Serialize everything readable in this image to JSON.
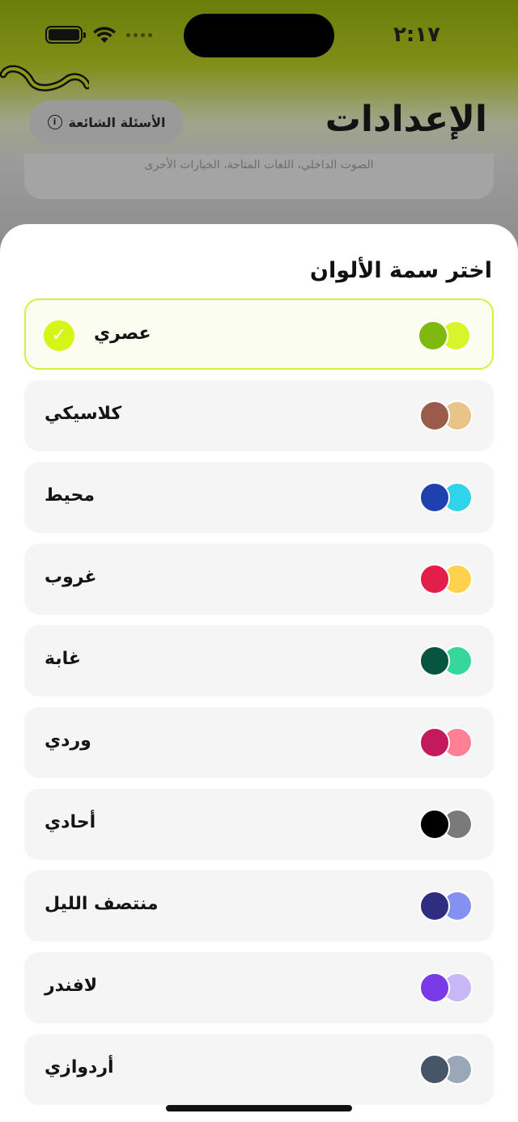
{
  "status_bar": {
    "time": "٢:١٧"
  },
  "header": {
    "title": "الإعدادات",
    "faq_label": "الأسئلة الشائعة",
    "faq_icon": "i",
    "bg_card_text": "الصوت الداخلي، اللغات المتاحة، الخيارات الأخرى"
  },
  "sheet": {
    "title": "اختر سمة الألوان",
    "check_mark": "✓",
    "themes": [
      {
        "name": "عصري",
        "primary": "#7fb80e",
        "secondary": "#d8f52c",
        "selected": true
      },
      {
        "name": "كلاسيكي",
        "primary": "#9a5b4a",
        "secondary": "#e9c488",
        "selected": false
      },
      {
        "name": "محيط",
        "primary": "#1f41b0",
        "secondary": "#2fd3ea",
        "selected": false
      },
      {
        "name": "غروب",
        "primary": "#e31e4b",
        "secondary": "#ffd24d",
        "selected": false
      },
      {
        "name": "غابة",
        "primary": "#07553f",
        "secondary": "#36d69c",
        "selected": false
      },
      {
        "name": "وردي",
        "primary": "#c21a5c",
        "secondary": "#ff7f94",
        "selected": false
      },
      {
        "name": "أحادي",
        "primary": "#000000",
        "secondary": "#7a7a7a",
        "selected": false
      },
      {
        "name": "منتصف الليل",
        "primary": "#2e2d80",
        "secondary": "#8491f2",
        "selected": false
      },
      {
        "name": "لافندر",
        "primary": "#7b3ae8",
        "secondary": "#c9b6f7",
        "selected": false
      },
      {
        "name": "أردوازي",
        "primary": "#475569",
        "secondary": "#9aa7b8",
        "selected": false
      }
    ]
  }
}
